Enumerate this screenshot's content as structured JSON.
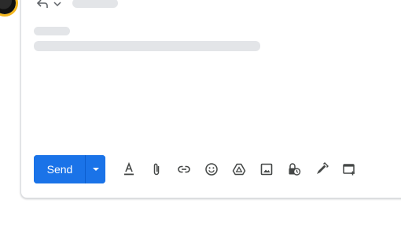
{
  "compose": {
    "send_label": "Send",
    "colors": {
      "accent": "#1a73e8",
      "icon": "#444746",
      "skeleton": "#e3e5e8"
    }
  },
  "toolbar": {
    "icons": [
      "text-format-icon",
      "attach-icon",
      "link-icon",
      "emoji-icon",
      "drive-icon",
      "photo-icon",
      "confidential-lock-icon",
      "signature-pen-icon",
      "schedule-calendar-icon"
    ]
  }
}
